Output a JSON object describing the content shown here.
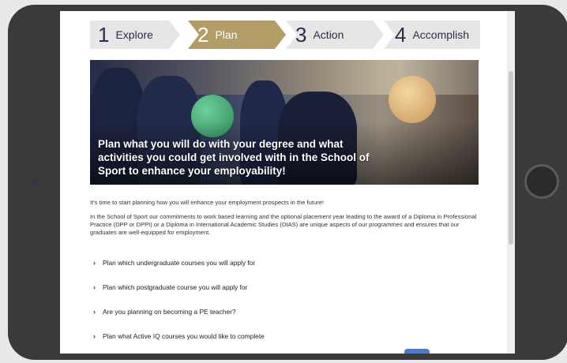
{
  "steps": [
    {
      "num": "1",
      "label": "Explore"
    },
    {
      "num": "2",
      "label": "Plan"
    },
    {
      "num": "3",
      "label": "Action"
    },
    {
      "num": "4",
      "label": "Accomplish"
    }
  ],
  "hero": {
    "caption": "Plan what you will do with your degree and what activities you could get involved with in the School of Sport to enhance your employability!"
  },
  "intro": "It's time to start planning how you will enhance your employment prospects in the future!",
  "body": "In the School of Sport our commitments to work based learning and the optional placement year leading to the award of a Diploma in Professional Practice (DPP or DPPI) or a Diploma in International Academic Studies (DIAS) are unique aspects of our programmes and ensures that our graduates are well-equipped for employment.",
  "list": [
    "Plan which undergraduate courses you will apply for",
    "Plan which postgraduate course you will apply for",
    "Are you planning on becoming a PE teacher?",
    "Plan what Active IQ courses you would like to complete"
  ],
  "colors": {
    "active_step": "#b29d67",
    "inactive_step": "#e6e6e6",
    "device_frame": "#3a3a3a"
  }
}
